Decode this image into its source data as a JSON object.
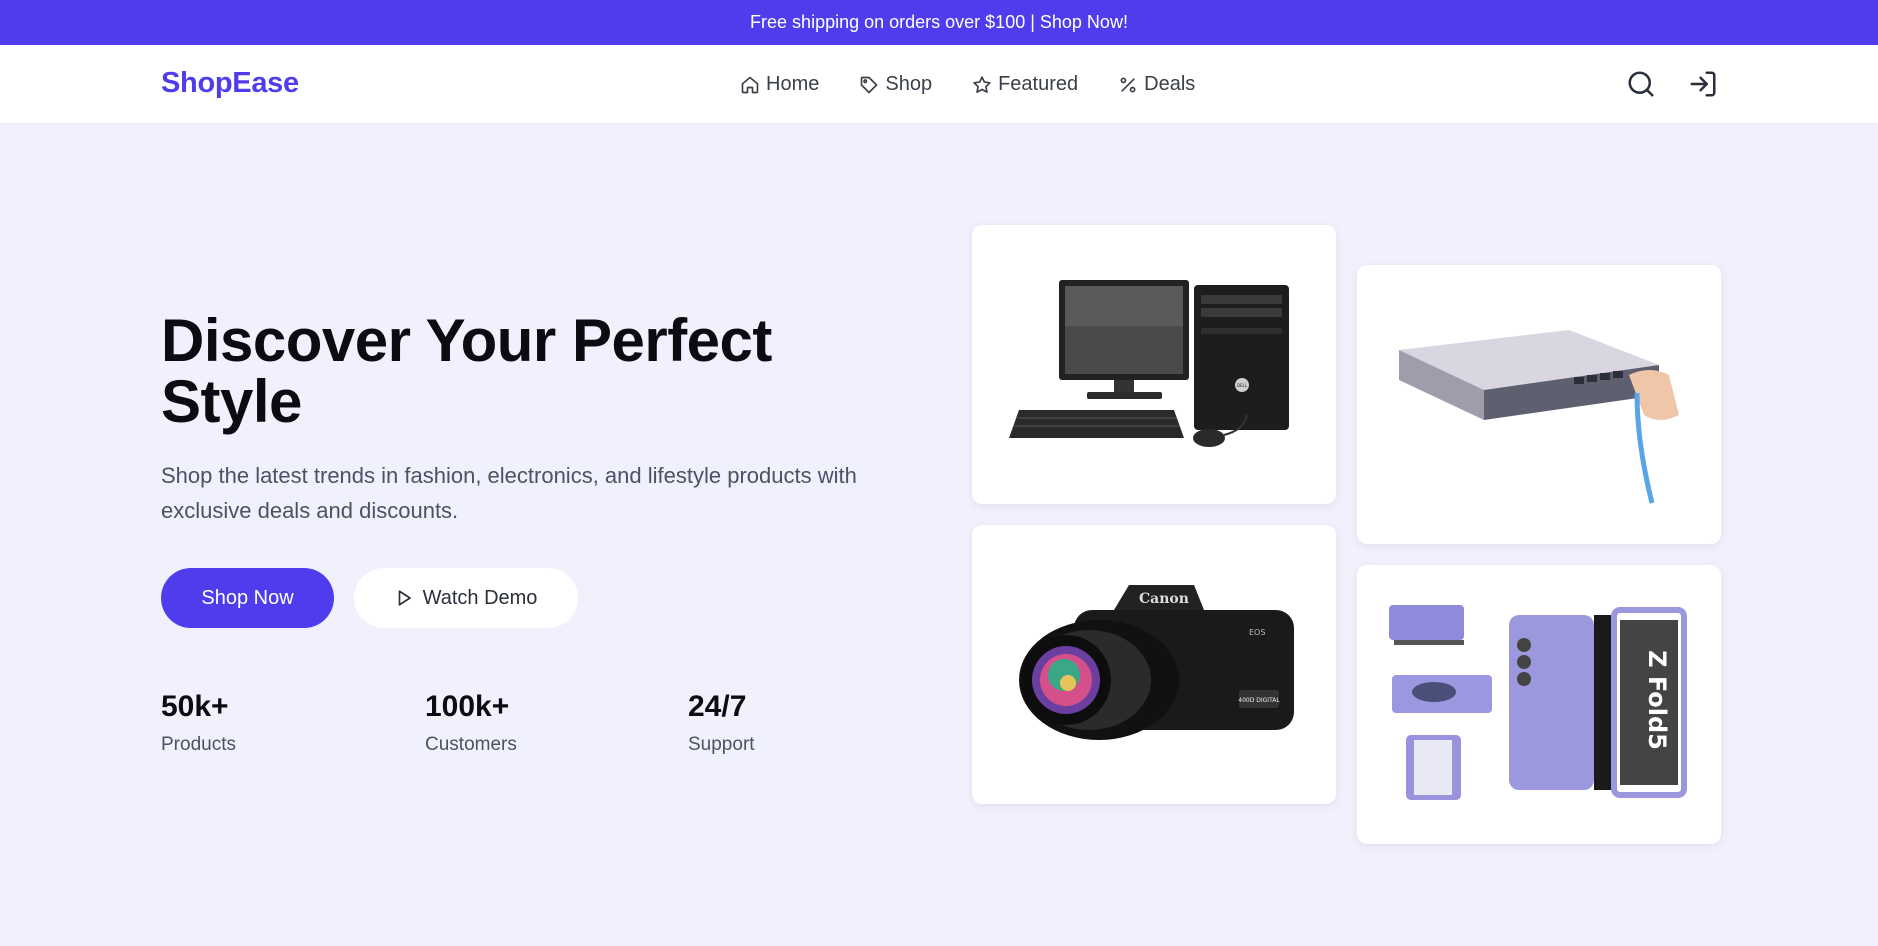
{
  "promo": {
    "text": "Free shipping on orders over $100 | Shop Now!"
  },
  "nav": {
    "logo": "ShopEase",
    "links": [
      {
        "label": "Home",
        "icon": "home-icon"
      },
      {
        "label": "Shop",
        "icon": "tag-icon"
      },
      {
        "label": "Featured",
        "icon": "star-icon"
      },
      {
        "label": "Deals",
        "icon": "percent-icon"
      }
    ],
    "actions": [
      {
        "icon": "search-icon"
      },
      {
        "icon": "login-icon"
      }
    ]
  },
  "hero": {
    "title_line1": "Discover Your Perfect",
    "title_line2": "Style",
    "subtitle": "Shop the latest trends in fashion, electronics, and lifestyle products with exclusive deals and discounts.",
    "primary_button": "Shop Now",
    "secondary_button": "Watch Demo",
    "stats": [
      {
        "value": "50k+",
        "label": "Products"
      },
      {
        "value": "100k+",
        "label": "Customers"
      },
      {
        "value": "24/7",
        "label": "Support"
      }
    ]
  },
  "products": [
    {
      "name": "desktop-computer-image",
      "image_lettering": "DELL"
    },
    {
      "name": "network-switch-image"
    },
    {
      "name": "dslr-camera-image",
      "image_lettering": [
        "Canon",
        "EOS",
        "400D DIGITAL"
      ]
    },
    {
      "name": "foldable-phone-image",
      "image_lettering": "Z Fold5"
    }
  ],
  "colors": {
    "brand": "#4f3ded",
    "background": "#f1f1fd",
    "text_muted": "#4b5263"
  }
}
